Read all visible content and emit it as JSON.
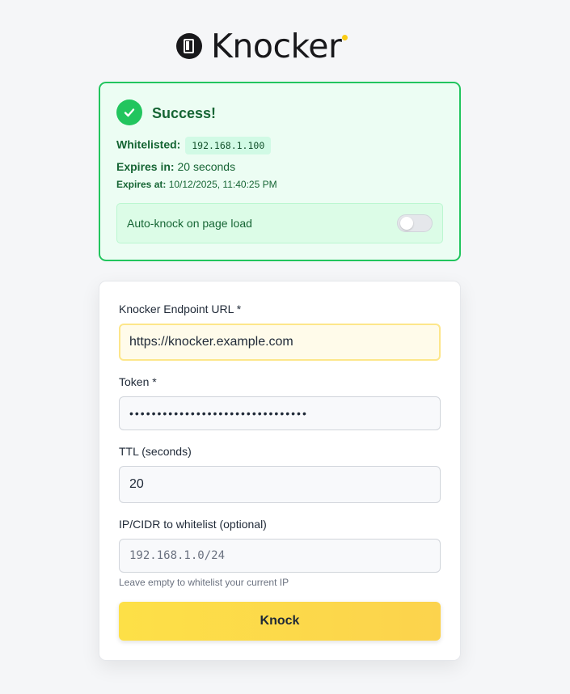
{
  "app": {
    "name": "Knocker"
  },
  "success": {
    "title": "Success!",
    "whitelisted_label": "Whitelisted:",
    "whitelisted_ip": "192.168.1.100",
    "expires_in_label": "Expires in:",
    "expires_in_value": "20 seconds",
    "expires_at_label": "Expires at:",
    "expires_at_value": "10/12/2025, 11:40:25 PM",
    "auto_knock_label": "Auto-knock on page load",
    "auto_knock_enabled": false
  },
  "form": {
    "endpoint_label": "Knocker Endpoint URL *",
    "endpoint_value": "https://knocker.example.com",
    "token_label": "Token *",
    "token_value": "••••••••••••••••••••••••••••••••",
    "ttl_label": "TTL (seconds)",
    "ttl_value": "20",
    "ip_label": "IP/CIDR to whitelist (optional)",
    "ip_placeholder": "192.168.1.0/24",
    "ip_hint": "Leave empty to whitelist your current IP",
    "submit_label": "Knock"
  },
  "colors": {
    "success_accent": "#22c55e",
    "button_accent": "#fcd34d",
    "logo_dot": "#facc15"
  },
  "icons": {
    "logo": "door-icon",
    "success": "check-icon"
  }
}
